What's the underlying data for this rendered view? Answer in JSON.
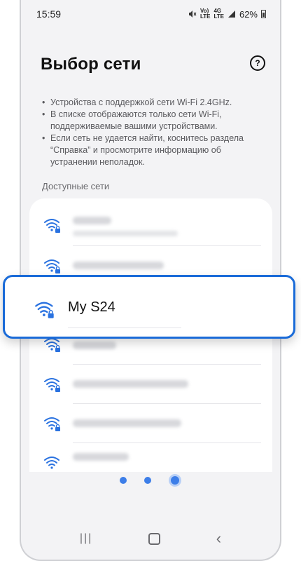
{
  "status": {
    "time": "15:59",
    "battery_pct": "62%",
    "icons": [
      "mute-icon",
      "volte-icon",
      "lte-4g-icon",
      "signal-icon",
      "battery-icon"
    ],
    "volte_label": "Vo)\nLTE",
    "net_label": "4G\nLTE"
  },
  "page": {
    "title": "Выбор сети",
    "help_glyph": "?",
    "bullets": [
      "Устройства с поддержкой сети Wi-Fi 2.4GHz.",
      "В списке отображаются только сети Wi-Fi, поддерживаемые вашими устройствами.",
      "Если сеть не удается найти, коснитесь раздела “Справка” и просмотрите информацию об устранении неполадок."
    ],
    "section_label": "Доступные сети"
  },
  "highlight": {
    "network_name": "My S24",
    "icon": "wifi-lock-icon"
  },
  "networks": [
    {
      "icon": "wifi-lock-icon",
      "name_obscured": true
    },
    {
      "icon": "wifi-lock-icon",
      "name_obscured": true
    },
    {
      "icon": "wifi-lock-icon",
      "name_obscured": true
    },
    {
      "icon": "wifi-lock-icon",
      "name_obscured": true
    },
    {
      "icon": "wifi-lock-icon",
      "name_obscured": true
    },
    {
      "icon": "wifi-lock-icon",
      "name_obscured": true
    },
    {
      "icon": "wifi-icon",
      "name_obscured": true
    }
  ],
  "pager": {
    "count": 3,
    "active_index": 2
  },
  "colors": {
    "accent": "#1a6bd8",
    "dot": "#3d7ee8",
    "wifi": "#2a72e0"
  },
  "navbar": {
    "recent": "|||",
    "back": "‹"
  }
}
